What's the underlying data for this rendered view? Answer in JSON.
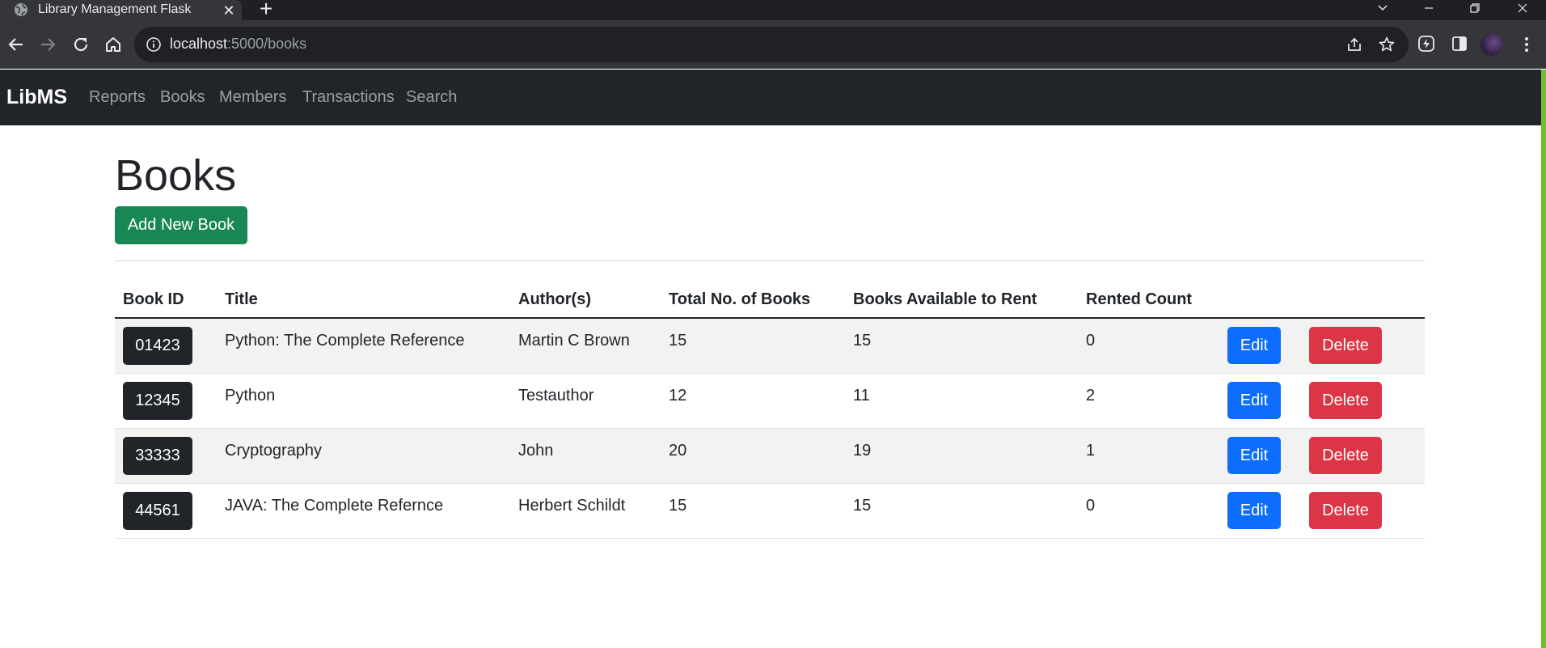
{
  "browser": {
    "tab_title": "Library Management Flask",
    "tab_close": "✕",
    "new_tab": "+",
    "url_host": "localhost",
    "url_path": ":5000/books"
  },
  "navbar": {
    "brand": "LibMS",
    "links": [
      "Reports",
      "Books",
      "Members",
      "Transactions",
      "Search"
    ]
  },
  "page": {
    "title": "Books",
    "add_button": "Add New Book"
  },
  "table": {
    "columns": [
      "Book ID",
      "Title",
      "Author(s)",
      "Total No. of Books",
      "Books Available to Rent",
      "Rented Count"
    ],
    "rows": [
      {
        "id": "01423",
        "title": "Python: The Complete Reference",
        "author": "Martin C Brown",
        "total": "15",
        "available": "15",
        "rented": "0"
      },
      {
        "id": "12345",
        "title": "Python",
        "author": "Testauthor",
        "total": "12",
        "available": "11",
        "rented": "2"
      },
      {
        "id": "33333",
        "title": "Cryptography",
        "author": "John",
        "total": "20",
        "available": "19",
        "rented": "1"
      },
      {
        "id": "44561",
        "title": "JAVA: The Complete Refernce",
        "author": "Herbert Schildt",
        "total": "15",
        "available": "15",
        "rented": "0"
      }
    ],
    "edit_label": "Edit",
    "delete_label": "Delete"
  },
  "colors": {
    "navbar_bg": "#212529",
    "add_button": "#198754",
    "edit_button": "#0d6efd",
    "delete_button": "#dc3545"
  }
}
